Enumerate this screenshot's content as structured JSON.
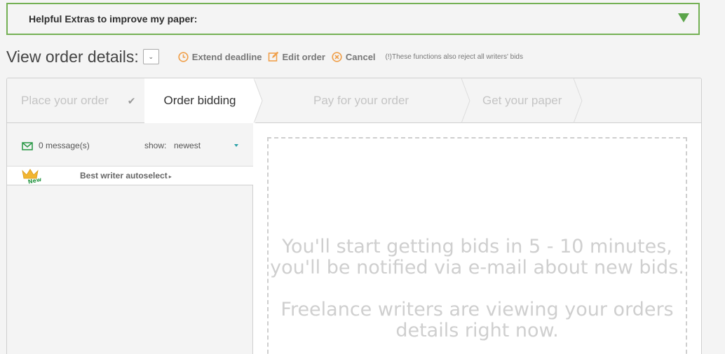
{
  "extras": {
    "title": "Helpful Extras to improve my paper:"
  },
  "details": {
    "title": "View order details:",
    "actions": {
      "extend": "Extend deadline",
      "edit": "Edit order",
      "cancel": "Cancel"
    },
    "note": "(!)These functions also reject all writers' bids"
  },
  "steps": [
    {
      "label": "Place your order",
      "completed": true
    },
    {
      "label": "Order bidding",
      "active": true
    },
    {
      "label": "Pay for your order"
    },
    {
      "label": "Get your paper"
    }
  ],
  "messages": {
    "count": "0 message(s)",
    "show_label": "show:",
    "show_value": "newest"
  },
  "autoselect": {
    "label": "Best writer autoselect",
    "badge": "New"
  },
  "bids": {
    "line1": "You'll start getting bids in 5 - 10 minutes,",
    "line2": "you'll be notified via e-mail about new bids.",
    "line3": "Freelance writers are viewing your orders",
    "line4": "details right now."
  },
  "colors": {
    "accent_green": "#5ba44a",
    "accent_orange": "#f0a04b",
    "link_teal": "#2aa1a7"
  }
}
